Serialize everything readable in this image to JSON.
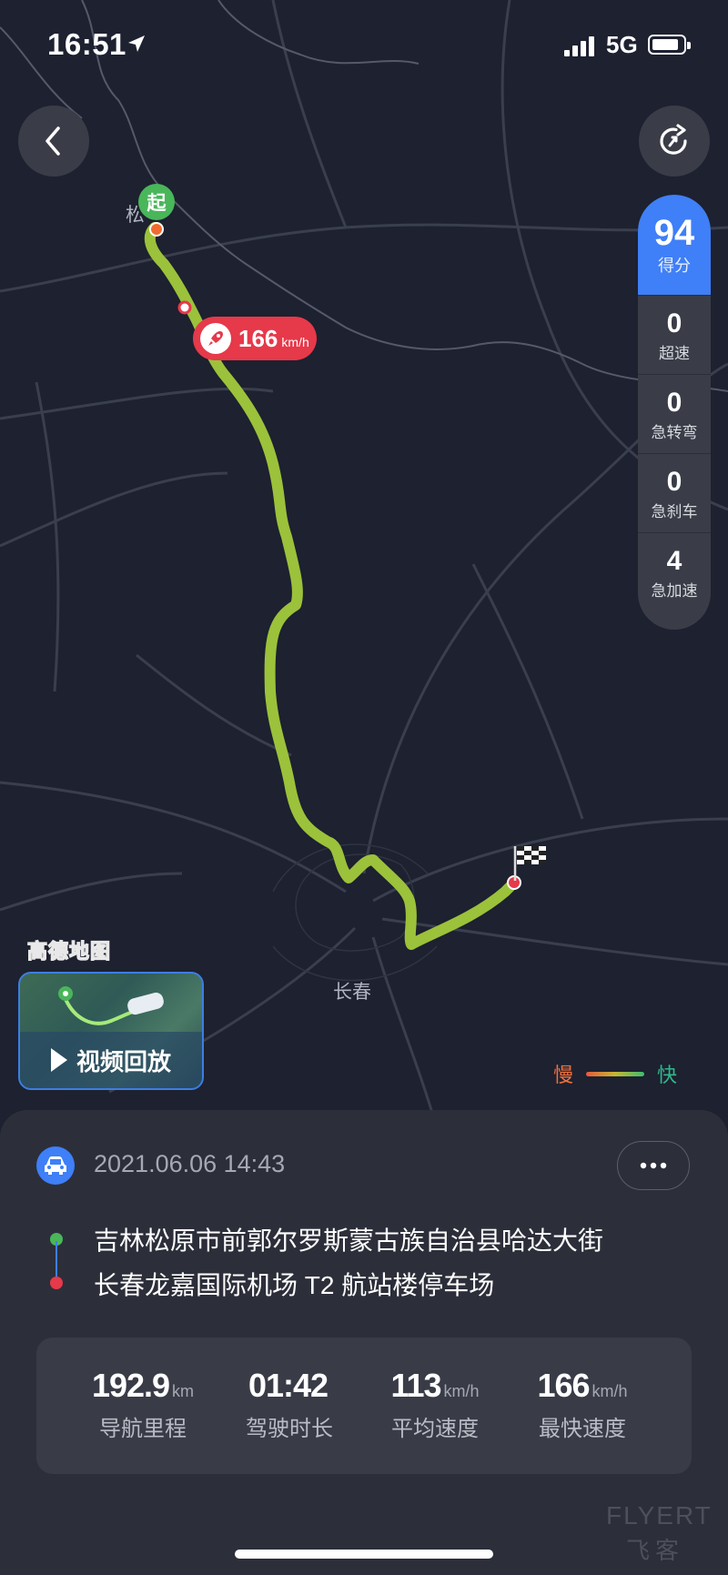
{
  "status_bar": {
    "time": "16:51",
    "network": "5G"
  },
  "map": {
    "city_labels": {
      "start_city": "松",
      "end_city": "长春"
    },
    "start_marker": "起",
    "provider_logo": "高德地图",
    "max_speed_bubble": {
      "value": "166",
      "unit": "km/h"
    },
    "video_replay_label": "视频回放",
    "legend": {
      "slow": "慢",
      "fast": "快"
    }
  },
  "score_panel": {
    "score": "94",
    "score_label": "得分",
    "metrics": [
      {
        "value": "0",
        "label": "超速"
      },
      {
        "value": "0",
        "label": "急转弯"
      },
      {
        "value": "0",
        "label": "急刹车"
      },
      {
        "value": "4",
        "label": "急加速"
      }
    ]
  },
  "trip": {
    "datetime": "2021.06.06 14:43",
    "start": "吉林松原市前郭尔罗斯蒙古族自治县哈达大街",
    "end": "长春龙嘉国际机场 T2 航站楼停车场",
    "stats": [
      {
        "value": "192.9",
        "unit": "km",
        "label": "导航里程"
      },
      {
        "value": "01:42",
        "unit": "",
        "label": "驾驶时长"
      },
      {
        "value": "113",
        "unit": "km/h",
        "label": "平均速度"
      },
      {
        "value": "166",
        "unit": "km/h",
        "label": "最快速度"
      }
    ]
  },
  "watermark": {
    "latin": "FLYERT",
    "chinese": "飞客"
  },
  "colors": {
    "accent": "#3f7ff7",
    "start": "#49b65a",
    "end": "#e6394a",
    "route": "#9bc23a"
  }
}
